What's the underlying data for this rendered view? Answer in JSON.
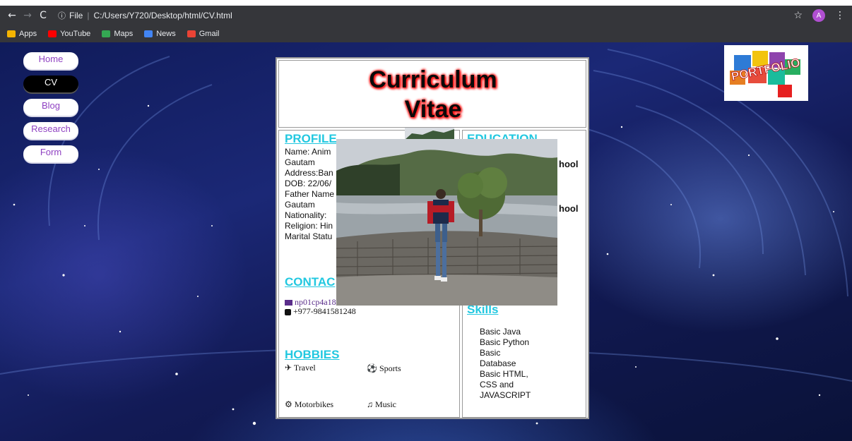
{
  "browser": {
    "back": "←",
    "forward": "→",
    "reload": "C",
    "info_icon": "ⓘ",
    "scheme": "File",
    "url": "C:/Users/Y720/Desktop/html/CV.html",
    "star": "☆",
    "avatar": "A",
    "menu": "⋮"
  },
  "bookmarks": [
    {
      "label": "Apps",
      "icon": "apps-grid-icon",
      "color": "#f4b400"
    },
    {
      "label": "YouTube",
      "icon": "youtube-icon",
      "color": "#ff0000"
    },
    {
      "label": "Maps",
      "icon": "maps-icon",
      "color": "#34a853"
    },
    {
      "label": "News",
      "icon": "news-icon",
      "color": "#4285f4"
    },
    {
      "label": "Gmail",
      "icon": "gmail-icon",
      "color": "#ea4335"
    }
  ],
  "nav": {
    "home": "Home",
    "cv": "CV",
    "blog": "Blog",
    "research": "Research",
    "form": "Form"
  },
  "logo": {
    "text": "PORTFOLIO"
  },
  "cv": {
    "title_line1": "Curriculum",
    "title_line2": "Vitae",
    "profile_heading": "PROFILE",
    "profile_lines": [
      "Name: Anim",
      "Gautam",
      "Address:Ban",
      "DOB: 22/06/",
      "Father Name",
      "Gautam",
      "Nationality: ",
      "Religion: Hin",
      "Marital Statu"
    ],
    "contact_heading": "CONTAC",
    "contact_email": "np01cp4a18",
    "contact_phone": "+977-9841581248",
    "hobbies_heading": "HOBBIES",
    "hobbies": {
      "travel": "Travel",
      "sports": "Sports",
      "motorbikes": "Motorbikes",
      "music": "Music"
    },
    "education_heading": "EDUCATION",
    "education_fragments": [
      "hool",
      "hool"
    ],
    "skills_heading": "Skills",
    "skills": [
      "Basic Java",
      "Basic Python",
      "Basic",
      "Database",
      "Basic HTML,",
      "CSS and",
      "JAVASCRIPT"
    ]
  },
  "colors": {
    "accent_cyan": "#22c8e0",
    "nav_text": "#8f41c2",
    "title_glow": "#ff1010"
  }
}
